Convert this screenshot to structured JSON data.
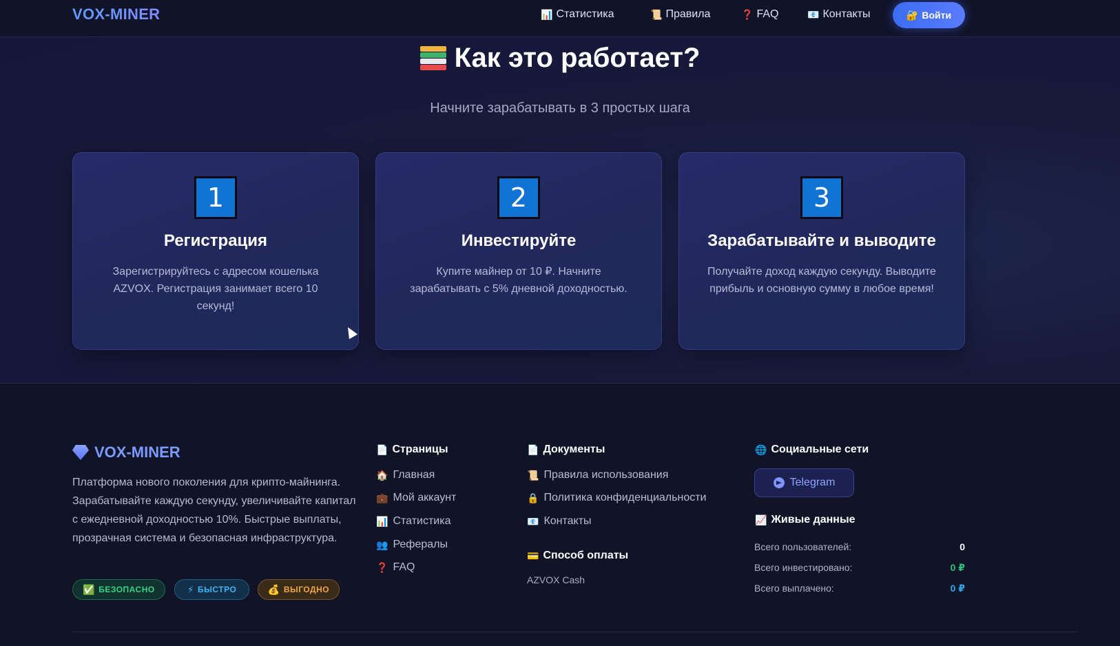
{
  "nav": {
    "logo": "VOX-MINER",
    "items": [
      {
        "label": "Статистика",
        "icon": "chart-icon"
      },
      {
        "label": "Правила",
        "icon": "scroll-icon"
      },
      {
        "label": "FAQ",
        "icon": "question-icon"
      },
      {
        "label": "Контакты",
        "icon": "envelope-icon"
      }
    ],
    "login_label": "Войти"
  },
  "how": {
    "title": "Как это работает?",
    "subtitle": "Начните зарабатывать в 3 простых шага",
    "steps": [
      {
        "number": "1",
        "title": "Регистрация",
        "text": "Зарегистрируйтесь с адресом кошелька AZVOX. Регистрация занимает всего 10 секунд!"
      },
      {
        "number": "2",
        "title": "Инвестируйте",
        "text": "Купите майнер от 10 ₽. Начните зарабатывать с 5% дневной доходностью."
      },
      {
        "number": "3",
        "title": "Зарабатывайте и выводите",
        "text": "Получайте доход каждую секунду. Выводите прибыль и основную сумму в любое время!"
      }
    ]
  },
  "footer": {
    "logo": "VOX-MINER",
    "description": "Платформа нового поколения для крипто-майнинга. Зарабатывайте каждую секунду, увеличивайте капитал с ежедневной доходностью 10%. Быстрые выплаты, прозрачная система и безопасная инфраструктура.",
    "badges": {
      "safe": "БЕЗОПАСНО",
      "fast": "БЫСТРО",
      "profit": "ВЫГОДНО"
    },
    "pages": {
      "heading": "Страницы",
      "links": [
        "Главная",
        "Мой аккаунт",
        "Статистика",
        "Рефералы",
        "FAQ"
      ]
    },
    "docs": {
      "heading": "Документы",
      "links": [
        "Правила использования",
        "Политика конфиденциальности",
        "Контакты"
      ]
    },
    "payment": {
      "heading": "Способ оплаты",
      "method": "AZVOX Cash"
    },
    "social": {
      "heading": "Социальные сети",
      "telegram": "Telegram"
    },
    "live": {
      "heading": "Живые данные",
      "users_label": "Всего пользователей:",
      "users_value": "0",
      "invested_label": "Всего инвестировано:",
      "invested_value": "0 ₽",
      "paid_label": "Всего выплачено:",
      "paid_value": "0 ₽"
    }
  },
  "colors": {
    "accent": "#3b6df0",
    "green": "#35d487",
    "cyan": "#3fb3f4",
    "orange": "#f0a646"
  }
}
